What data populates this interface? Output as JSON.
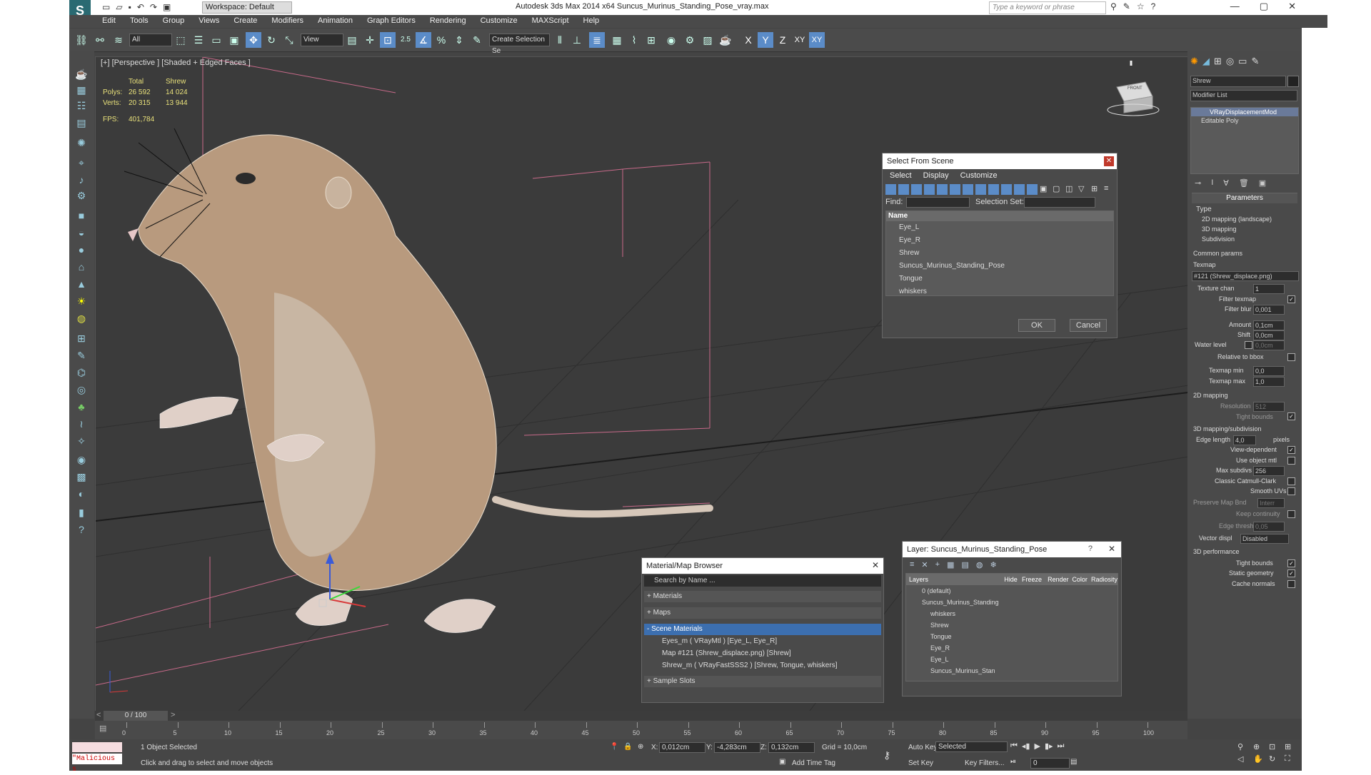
{
  "titlebar": {
    "title": "Autodesk 3ds Max  2014 x64     Suncus_Murinus_Standing_Pose_vray.max",
    "workspace": "Workspace: Default",
    "search_placeholder": "Type a keyword or phrase"
  },
  "menu": [
    "Edit",
    "Tools",
    "Group",
    "Views",
    "Create",
    "Modifiers",
    "Animation",
    "Graph Editors",
    "Rendering",
    "Customize",
    "MAXScript",
    "Help"
  ],
  "toolbar": {
    "filter": "All",
    "ref_coord": "View",
    "selection_set": "Create Selection Se",
    "snap_label": "2.5",
    "axes": [
      "X",
      "Y",
      "Z",
      "XY",
      "XY"
    ]
  },
  "viewport": {
    "label": "[+] [Perspective ] [Shaded + Edged Faces ]",
    "stats": {
      "head_total": "Total",
      "head_obj": "Shrew",
      "polys_label": "Polys:",
      "polys_total": "26 592",
      "polys_obj": "14 024",
      "verts_label": "Verts:",
      "verts_total": "20 315",
      "verts_obj": "13 944",
      "fps_label": "FPS:",
      "fps_value": "401,784"
    },
    "viewcube": "FRONT"
  },
  "select_scene": {
    "title": "Select From Scene",
    "menu": [
      "Select",
      "Display",
      "Customize"
    ],
    "find_label": "Find:",
    "selset_label": "Selection Set:",
    "column": "Name",
    "items": [
      "Eye_L",
      "Eye_R",
      "Shrew",
      "Suncus_Murinus_Standing_Pose",
      "Tongue",
      "whiskers"
    ],
    "ok": "OK",
    "cancel": "Cancel"
  },
  "material_browser": {
    "title": "Material/Map Browser",
    "search": "Search by Name ...",
    "groups": [
      "+ Materials",
      "+ Maps",
      "- Scene Materials"
    ],
    "items": [
      "Eyes_m  ( VRayMtl )  [Eye_L, Eye_R]",
      "Map #121 (Shrew_displace.png)  [Shrew]",
      "Shrew_m  ( VRayFastSSS2 )  [Shrew, Tongue, whiskers]"
    ],
    "sample": "+ Sample Slots"
  },
  "layer_dialog": {
    "title": "Layer: Suncus_Murinus_Standing_Pose",
    "help": "?",
    "columns": [
      "Layers",
      "Hide",
      "Freeze",
      "Render",
      "Color",
      "Radiosity"
    ],
    "rows": [
      "0 (default)",
      "Suncus_Murinus_Standing",
      "whiskers",
      "Shrew",
      "Tongue",
      "Eye_R",
      "Eye_L",
      "Suncus_Murinus_Stan"
    ]
  },
  "right_panel": {
    "object_name": "Shrew",
    "modifier_list": "Modifier List",
    "stack": [
      "VRayDisplacementMod",
      "Editable Poly"
    ],
    "parameters": "Parameters",
    "type_label": "Type",
    "types": [
      "2D mapping (landscape)",
      "3D mapping",
      "Subdivision"
    ],
    "common": "Common params",
    "texmap": "Texmap",
    "texmap_value": "#121 (Shrew_displace.png)",
    "texture_chan": "Texture chan",
    "texture_chan_v": "1",
    "filter_texmap": "Filter texmap",
    "filter_blur": "Filter blur",
    "filter_blur_v": "0,001",
    "amount": "Amount",
    "amount_v": "0,1cm",
    "shift": "Shift",
    "shift_v": "0,0cm",
    "water": "Water level",
    "water_v": "0,0cm",
    "rel_bbox": "Relative to bbox",
    "texmap_min": "Texmap min",
    "texmap_min_v": "0,0",
    "texmap_max": "Texmap max",
    "texmap_max_v": "1,0",
    "map2d": "2D mapping",
    "resolution": "Resolution",
    "resolution_v": "512",
    "tight": "Tight bounds",
    "map3d": "3D mapping/subdivision",
    "edge_len": "Edge length",
    "edge_len_v": "4,0",
    "pixels": "pixels",
    "view_dep": "View-dependent",
    "use_obj": "Use object mtl",
    "max_subdivs": "Max subdivs",
    "max_subdivs_v": "256",
    "catmull": "Classic Catmull-Clark",
    "smooth_uv": "Smooth UVs",
    "preserve": "Preserve Map Bnd",
    "preserve_v": "Interr",
    "keep": "Keep continuity",
    "edge_thresh": "Edge thresh",
    "edge_thresh_v": "0,05",
    "vector": "Vector displ",
    "vector_v": "Disabled",
    "perf": "3D performance",
    "tight2": "Tight bounds",
    "static": "Static geometry",
    "cache": "Cache normals"
  },
  "timeline": {
    "frame": "0 / 100",
    "ticks": [
      "0",
      "5",
      "10",
      "15",
      "20",
      "25",
      "30",
      "35",
      "40",
      "45",
      "50",
      "55",
      "60",
      "65",
      "70",
      "75",
      "80",
      "85",
      "90",
      "95",
      "100"
    ]
  },
  "status": {
    "script": "\"Malicious s",
    "selected": "1 Object Selected",
    "hint": "Click and drag to select and move objects",
    "x": "0,012cm",
    "y": "-4,283cm",
    "z": "0,132cm",
    "grid": "Grid = 10,0cm",
    "add_time_tag": "Add Time Tag",
    "auto_key": "Auto Key",
    "set_key": "Set Key",
    "key_mode": "Selected",
    "key_filters": "Key Filters...",
    "frame": "0"
  }
}
